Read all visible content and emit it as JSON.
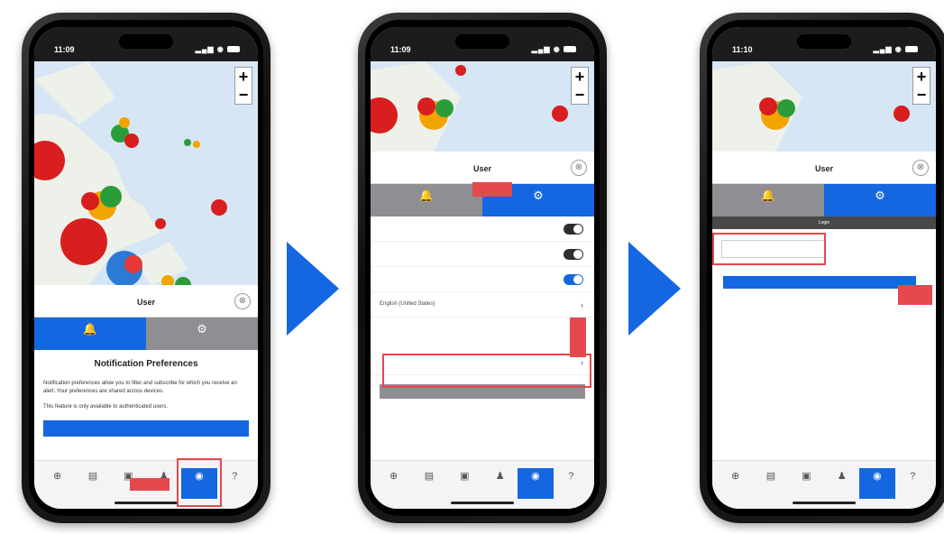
{
  "colors": {
    "accent": "#1467e0",
    "inactive_tab": "#8e8e93",
    "highlight": "#e5484d",
    "arrow": "#1467e0"
  },
  "screens": [
    {
      "status_time": "11:09",
      "sheet_title": "User",
      "sheet_small_label": "",
      "tabs": [
        {
          "label": "",
          "icon": "bell-icon",
          "active": true
        },
        {
          "label": "",
          "icon": "gear-icon",
          "active": false
        }
      ],
      "heading": "Notification Preferences",
      "body_text": "Notification preferences allow you to filter and subscribe for which you receive an alert. Your preferences are shared across devices.",
      "note_text": "This feature is only available to authenticated users.",
      "login_button": "",
      "tabbar_active_icon": "user-icon"
    },
    {
      "status_time": "11:09",
      "sheet_title": "User",
      "tabs": [
        {
          "label": "",
          "icon": "bell-icon",
          "active": false
        },
        {
          "label": "",
          "icon": "gear-icon",
          "active": true
        }
      ],
      "rows": [
        {
          "label": "",
          "control": "toggle",
          "on": false
        },
        {
          "label": "",
          "control": "toggle",
          "on": false
        },
        {
          "label": "",
          "control": "toggle",
          "on": true
        },
        {
          "label": "English (United States)",
          "control": "chevron"
        }
      ],
      "section_labels": [
        "",
        ""
      ],
      "environment_row": "",
      "grey_button": "",
      "tabbar_active_icon": "user-icon"
    },
    {
      "status_time": "11:10",
      "sheet_title": "User",
      "tabs": [
        {
          "label": "",
          "icon": "bell-icon",
          "active": false
        },
        {
          "label": "",
          "icon": "gear-icon",
          "active": true
        }
      ],
      "login_bar": "Login",
      "field_label": "",
      "field_value": "",
      "field_hint": "",
      "continue_button": "",
      "tabbar_active_icon": "user-icon"
    }
  ],
  "tabbar_icons": [
    "map-pin-icon",
    "list-icon",
    "chat-icon",
    "person-icon",
    "user-icon",
    "help-icon"
  ]
}
